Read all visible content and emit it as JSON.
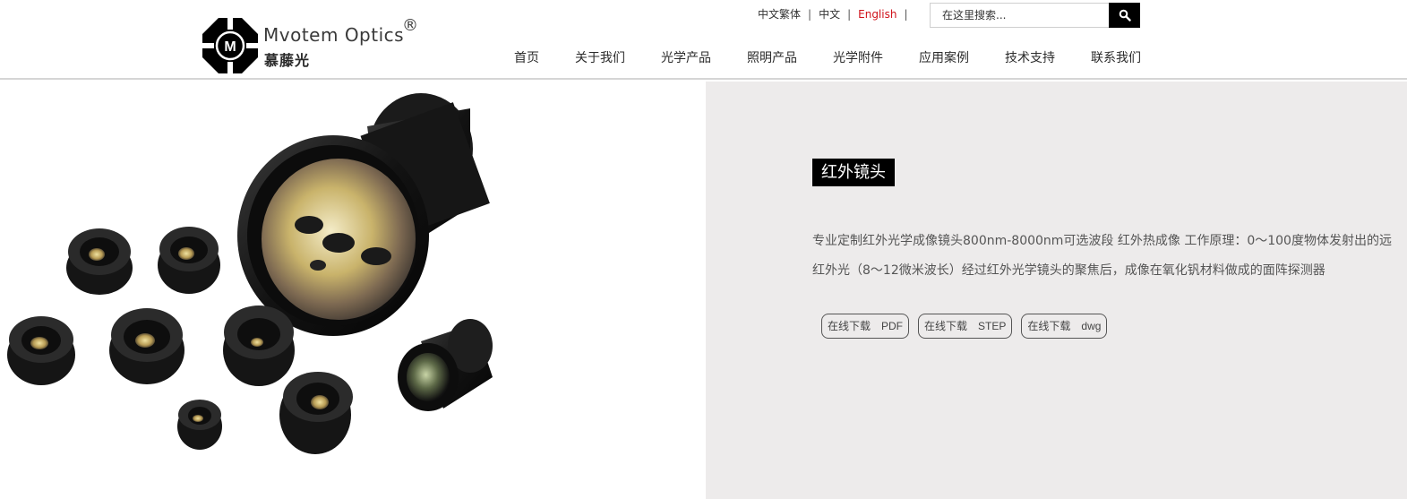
{
  "brand": {
    "name_en": "Mvotem Optics",
    "registered_mark": "®",
    "name_cn": "慕藤光",
    "logo_letter": "M"
  },
  "language_bar": [
    {
      "label": "中文繁体",
      "active": false
    },
    {
      "label": "中文",
      "active": false
    },
    {
      "label": "English",
      "active": true
    }
  ],
  "search": {
    "placeholder": "在这里搜索...",
    "button_icon": "search-icon"
  },
  "nav": {
    "items": [
      "首页",
      "关于我们",
      "光学产品",
      "照明产品",
      "光学附件",
      "应用案例",
      "技术支持",
      "联系我们"
    ]
  },
  "product": {
    "title": "红外镜头",
    "description": "专业定制红外光学成像镜头800nm-8000nm可选波段 红外热成像 工作原理：0～100度物体发射出的远红外光（8～12微米波长）经过红外光学镜头的聚焦后，成像在氧化钒材料做成的面阵探测器",
    "image_alt": "infrared lenses product photo",
    "downloads": [
      {
        "prefix": "在线下载",
        "format": "PDF"
      },
      {
        "prefix": "在线下载",
        "format": "STEP"
      },
      {
        "prefix": "在线下载",
        "format": "dwg"
      }
    ]
  },
  "colors": {
    "accent_red": "#d0121b",
    "panel_bg": "#edebeb",
    "title_bg": "#000000"
  }
}
